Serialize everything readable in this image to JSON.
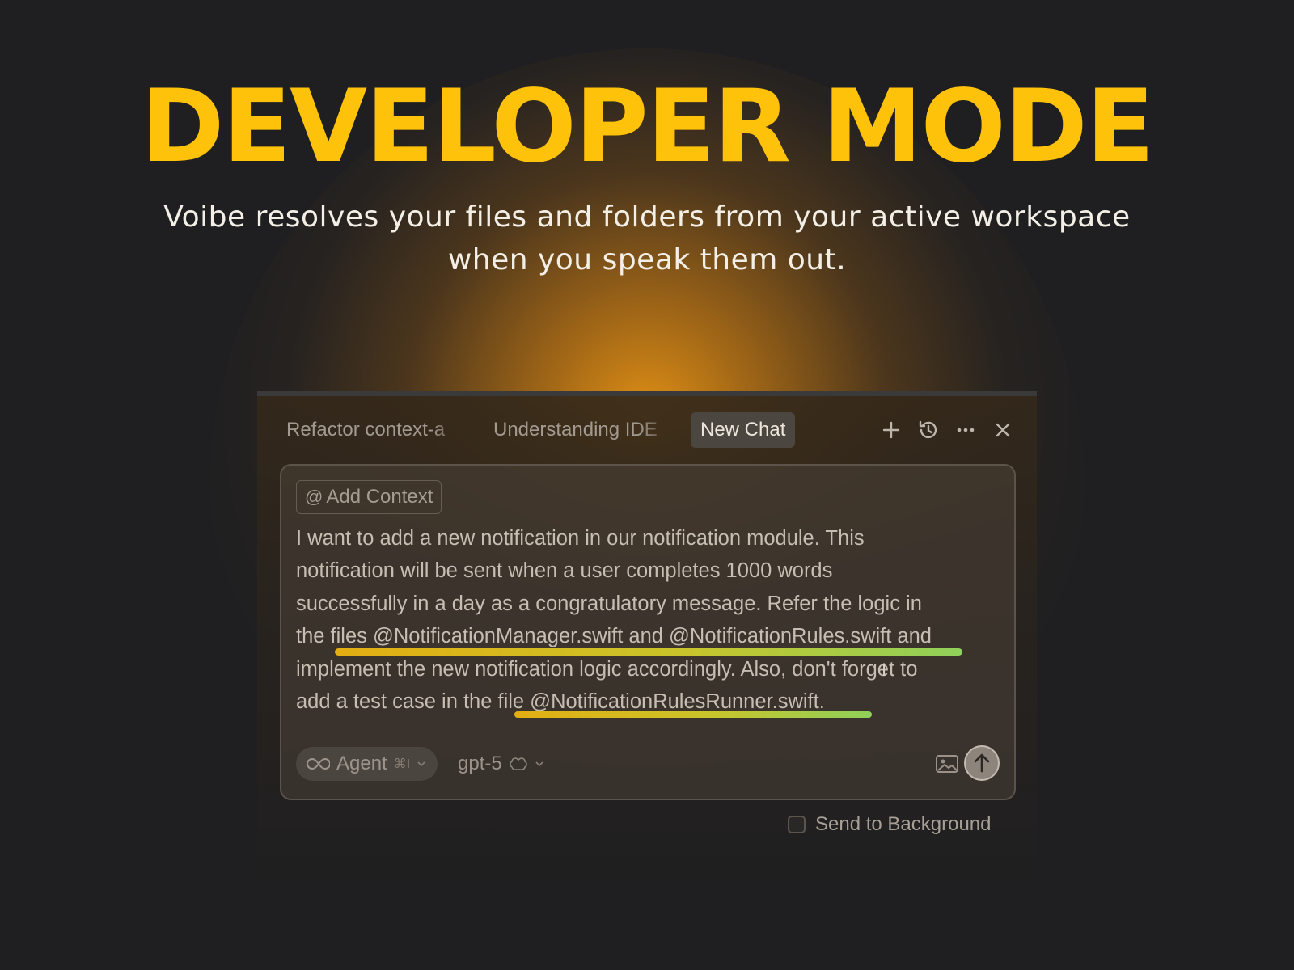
{
  "hero": {
    "title": "DEVELOPER MODE",
    "subtitle_line1": "Voibe resolves your files and folders from your active workspace",
    "subtitle_line2": "when you speak them out."
  },
  "colors": {
    "accent": "#ffc20a",
    "highlight_start": "#e3ae12",
    "highlight_end": "#8fd15a"
  },
  "chat": {
    "tabs": [
      {
        "label": "Refactor context-a",
        "active": false
      },
      {
        "label": "Understanding IDE",
        "active": false
      },
      {
        "label": "New Chat",
        "active": true
      }
    ],
    "toolbar_icons": [
      "plus-icon",
      "history-icon",
      "more-icon",
      "close-icon"
    ],
    "add_context_label": "Add Context",
    "message_lines": [
      "I want to add a new notification in our notification module. This",
      "notification will be sent when a user completes 1000 words",
      "successfully in a day as a congratulatory message. Refer the logic in",
      "the files @NotificationManager.swift and @NotificationRules.swift and",
      "implement the new notification logic accordingly. Also, don't forget to",
      "add a test case in the file @NotificationRulesRunner.swift."
    ],
    "mode_label": "Agent",
    "mode_shortcut": "⌘I",
    "model_label": "gpt-5",
    "send_to_background_label": "Send to Background",
    "send_to_background_checked": false
  }
}
